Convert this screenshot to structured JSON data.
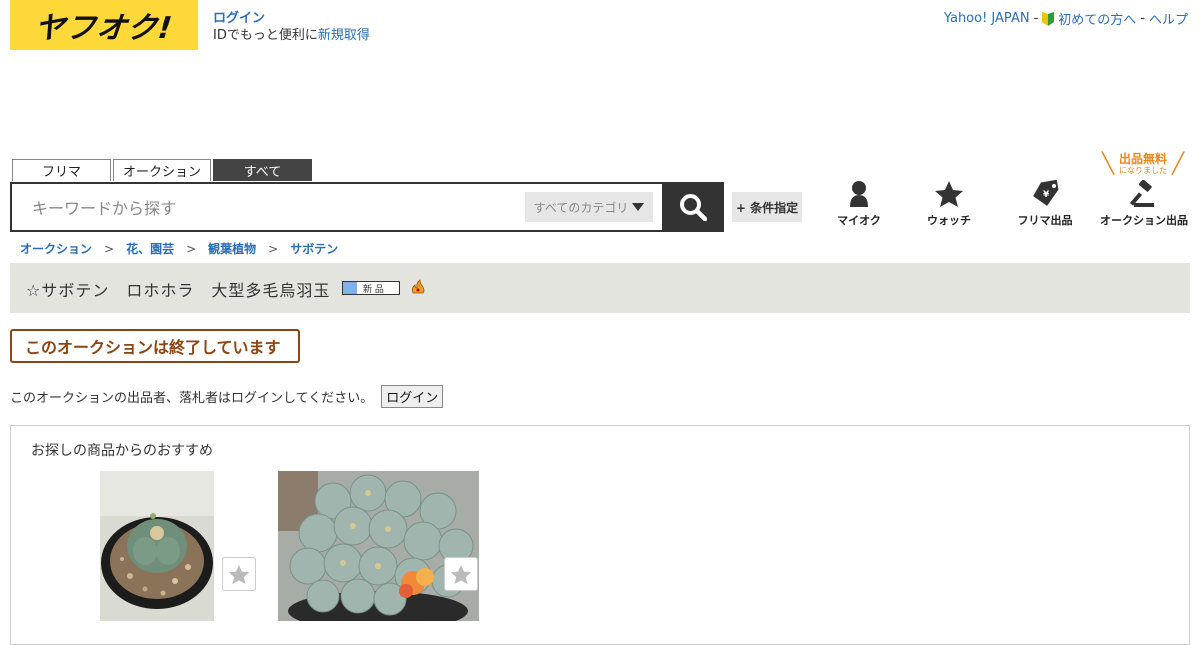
{
  "header": {
    "logo_text": "ヤフオク!",
    "login_label": "ログイン",
    "id_text": "IDでもっと便利に",
    "signup_label": "新規取得",
    "yahoo_japan": "Yahoo! JAPAN",
    "first_time": "初めての方へ",
    "help": "ヘルプ",
    "sep": "-"
  },
  "tabs": [
    {
      "label": "フリマ",
      "active": false
    },
    {
      "label": "オークション",
      "active": false
    },
    {
      "label": "すべて",
      "active": true
    }
  ],
  "search": {
    "placeholder": "キーワードから探す",
    "category": "すべてのカテゴリ",
    "condition": "+ 条件指定"
  },
  "nav": {
    "myauc": "マイオク",
    "watch": "ウォッチ",
    "flea_sell": "フリマ出品",
    "auction_sell": "オークション出品",
    "free_l1": "出品無料",
    "free_l2": "になりました"
  },
  "breadcrumb": [
    "オークション",
    "花、園芸",
    "観葉植物",
    "サボテン"
  ],
  "breadcrumb_sep": ">",
  "item": {
    "title": "☆サボテン　ロホホラ　大型多毛烏羽玉",
    "new_badge": "新 品"
  },
  "ended_notice": "このオークションは終了しています",
  "login_message": "このオークションの出品者、落札者はログインしてください。",
  "login_button": "ログイン",
  "recommend": {
    "title": "お探しの商品からのおすすめ"
  },
  "colors": {
    "logo_bg": "#fcd838",
    "link": "#2a6eb8",
    "ended": "#8b4513",
    "accent_orange": "#e7871e"
  }
}
